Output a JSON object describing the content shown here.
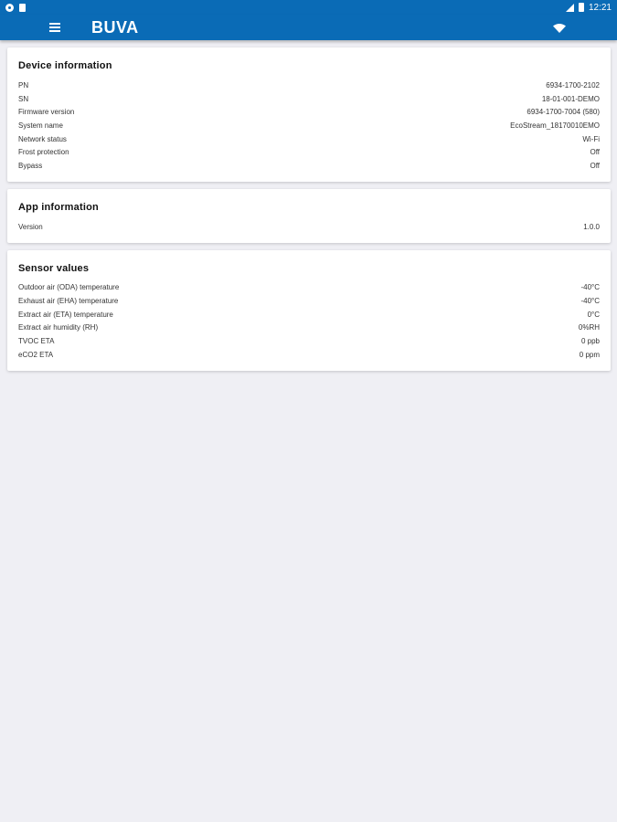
{
  "status_bar": {
    "time": "12:21",
    "left_icons": [
      "settings-icon",
      "sd-card-icon"
    ],
    "right_icons": [
      "signal-icon",
      "battery-icon"
    ]
  },
  "app_bar": {
    "title": "BUVA",
    "menu_icon": "hamburger-menu-icon",
    "wifi_icon": "wifi-icon",
    "color": "#0a6bb6"
  },
  "device_information": {
    "title": "Device information",
    "rows": [
      {
        "label": "PN",
        "value": "6934-1700-2102"
      },
      {
        "label": "SN",
        "value": "18-01-001-DEMO"
      },
      {
        "label": "Firmware version",
        "value": "6934-1700-7004 (580)"
      },
      {
        "label": "System name",
        "value": "EcoStream_18170010EMO"
      },
      {
        "label": "Network status",
        "value": "Wi-Fi"
      },
      {
        "label": "Frost protection",
        "value": "Off"
      },
      {
        "label": "Bypass",
        "value": "Off"
      }
    ]
  },
  "app_information": {
    "title": "App information",
    "rows": [
      {
        "label": "Version",
        "value": "1.0.0"
      }
    ]
  },
  "sensor_values": {
    "title": "Sensor values",
    "rows": [
      {
        "label": "Outdoor air (ODA) temperature",
        "value": "-40°C"
      },
      {
        "label": "Exhaust air (EHA) temperature",
        "value": "-40°C"
      },
      {
        "label": "Extract air (ETA) temperature",
        "value": "0°C"
      },
      {
        "label": "Extract air humidity (RH)",
        "value": "0%RH"
      },
      {
        "label": "TVOC ETA",
        "value": "0 ppb"
      },
      {
        "label": "eCO2 ETA",
        "value": "0 ppm"
      }
    ]
  }
}
